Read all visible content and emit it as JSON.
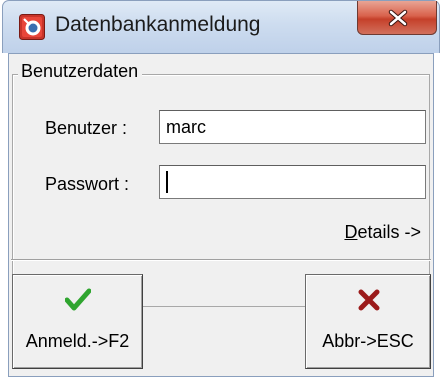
{
  "window": {
    "title": "Datenbankanmeldung",
    "close_label": "X"
  },
  "group": {
    "legend": "Benutzerdaten"
  },
  "fields": {
    "user_label": "Benutzer :",
    "user_value": "marc",
    "password_label": "Passwort :",
    "password_value": ""
  },
  "details": {
    "mnemonic": "D",
    "rest": "etails ->"
  },
  "buttons": {
    "login_label": "Anmeld.->F2",
    "cancel_label": "Abbr->ESC"
  },
  "colors": {
    "check": "#2fa52f",
    "cross": "#9b1b1b",
    "close_red": "#c5402a"
  }
}
